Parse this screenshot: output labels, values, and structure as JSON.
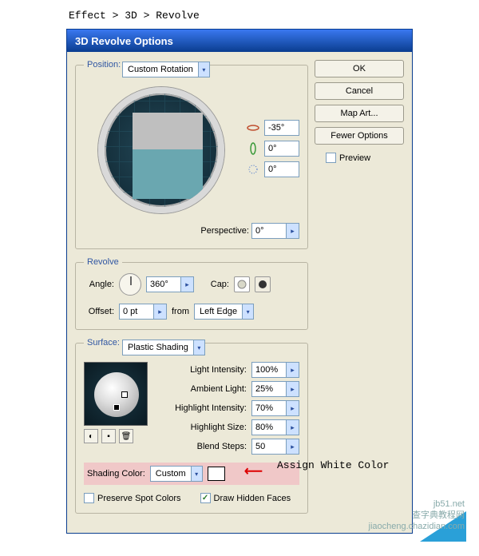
{
  "menu_path": "Effect > 3D > Revolve",
  "title": "3D Revolve Options",
  "buttons": {
    "ok": "OK",
    "cancel": "Cancel",
    "map": "Map Art...",
    "fewer": "Fewer Options",
    "preview": "Preview"
  },
  "preview_checked": false,
  "position": {
    "legend": "Position:",
    "preset": "Custom Rotation",
    "rot_x": "-35°",
    "rot_y": "0°",
    "rot_z": "0°",
    "perspective_label": "Perspective:",
    "perspective": "0°"
  },
  "revolve": {
    "legend": "Revolve",
    "angle_label": "Angle:",
    "angle": "360°",
    "cap_label": "Cap:",
    "offset_label": "Offset:",
    "offset": "0 pt",
    "from_label": "from",
    "from": "Left Edge"
  },
  "surface": {
    "legend": "Surface:",
    "shading": "Plastic Shading",
    "light_intensity_label": "Light Intensity:",
    "light_intensity": "100%",
    "ambient_label": "Ambient Light:",
    "ambient": "25%",
    "hi_intensity_label": "Highlight Intensity:",
    "hi_intensity": "70%",
    "hi_size_label": "Highlight Size:",
    "hi_size": "80%",
    "blend_label": "Blend Steps:",
    "blend": "50",
    "shading_color_label": "Shading Color:",
    "shading_color": "Custom",
    "preserve_label": "Preserve Spot Colors",
    "preserve": false,
    "hidden_label": "Draw Hidden Faces",
    "hidden": true
  },
  "annotation": "Assign White Color",
  "watermark": {
    "l1": "jb51.net",
    "l2": "查字典教程网",
    "l3": "jiaocheng.chazidian.com"
  }
}
